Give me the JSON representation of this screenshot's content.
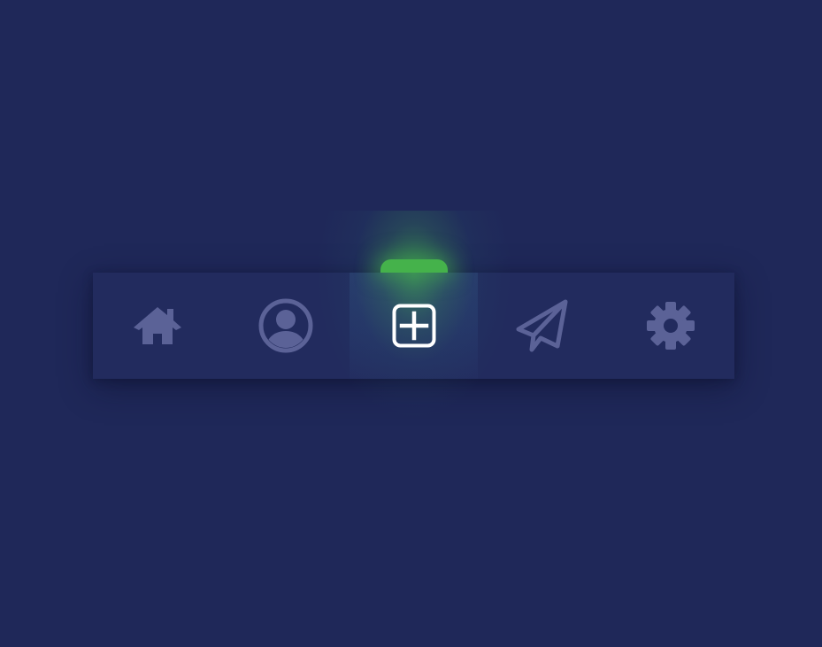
{
  "nav": {
    "active_index": 2,
    "items": [
      {
        "id": "home",
        "icon": "home-icon",
        "active": false
      },
      {
        "id": "profile",
        "icon": "user-circle-icon",
        "active": false
      },
      {
        "id": "add",
        "icon": "plus-square-icon",
        "active": true
      },
      {
        "id": "send",
        "icon": "paper-plane-icon",
        "active": false
      },
      {
        "id": "settings",
        "icon": "gear-icon",
        "active": false
      }
    ]
  },
  "colors": {
    "background": "#1f2859",
    "navbar": "#222b5e",
    "icon_inactive": "#5b6297",
    "icon_active": "#ffffff",
    "accent": "#45b24b"
  }
}
